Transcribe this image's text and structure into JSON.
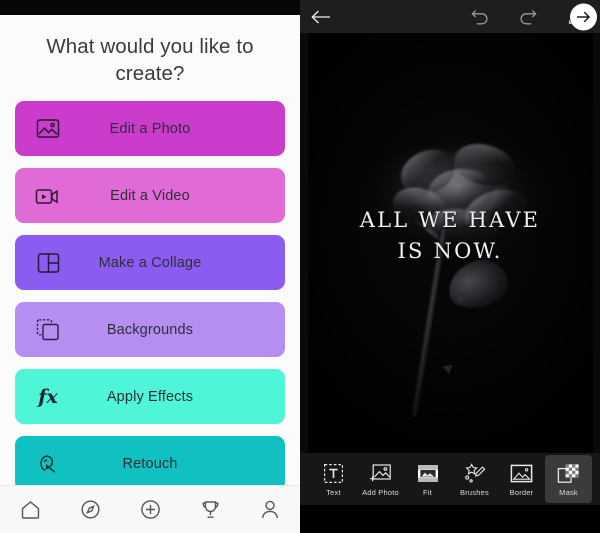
{
  "left": {
    "status_bar": "",
    "headline": "What would you like to create?",
    "actions": [
      {
        "label": "Edit a Photo",
        "icon": "photo-icon",
        "color": "#cc3ccc"
      },
      {
        "label": "Edit a Video",
        "icon": "video-icon",
        "color": "#e06bd6"
      },
      {
        "label": "Make a Collage",
        "icon": "collage-icon",
        "color": "#8b5cf0"
      },
      {
        "label": "Backgrounds",
        "icon": "backgrounds-icon",
        "color": "#b48ef0"
      },
      {
        "label": "Apply Effects",
        "icon": "effects-fx-icon",
        "color": "#4ef5d7"
      },
      {
        "label": "Retouch",
        "icon": "retouch-icon",
        "color": "#11c0c0"
      }
    ],
    "nav": [
      {
        "label": "Home",
        "icon": "home-icon"
      },
      {
        "label": "Discover",
        "icon": "compass-icon"
      },
      {
        "label": "Create",
        "icon": "plus-circle-icon"
      },
      {
        "label": "Challenges",
        "icon": "trophy-icon"
      },
      {
        "label": "Profile",
        "icon": "person-icon"
      }
    ]
  },
  "editor": {
    "topbar": {
      "back": "back-arrow-icon",
      "undo": "undo-icon",
      "redo": "redo-icon",
      "save": "download-icon",
      "next": "next-arrow-icon"
    },
    "canvas": {
      "artwork": "dark-rose-photo",
      "overlay_line1": "ALL WE HAVE",
      "overlay_line2": "IS NOW."
    },
    "tools": [
      {
        "label": "Text",
        "icon": "text-icon",
        "selected": false
      },
      {
        "label": "Add Photo",
        "icon": "add-photo-icon",
        "selected": false
      },
      {
        "label": "Fit",
        "icon": "fit-icon",
        "selected": false
      },
      {
        "label": "Brushes",
        "icon": "brushes-icon",
        "selected": false
      },
      {
        "label": "Border",
        "icon": "border-icon",
        "selected": false
      },
      {
        "label": "Mask",
        "icon": "mask-icon",
        "selected": true
      },
      {
        "label": "",
        "icon": "more-icon",
        "selected": false
      }
    ]
  }
}
